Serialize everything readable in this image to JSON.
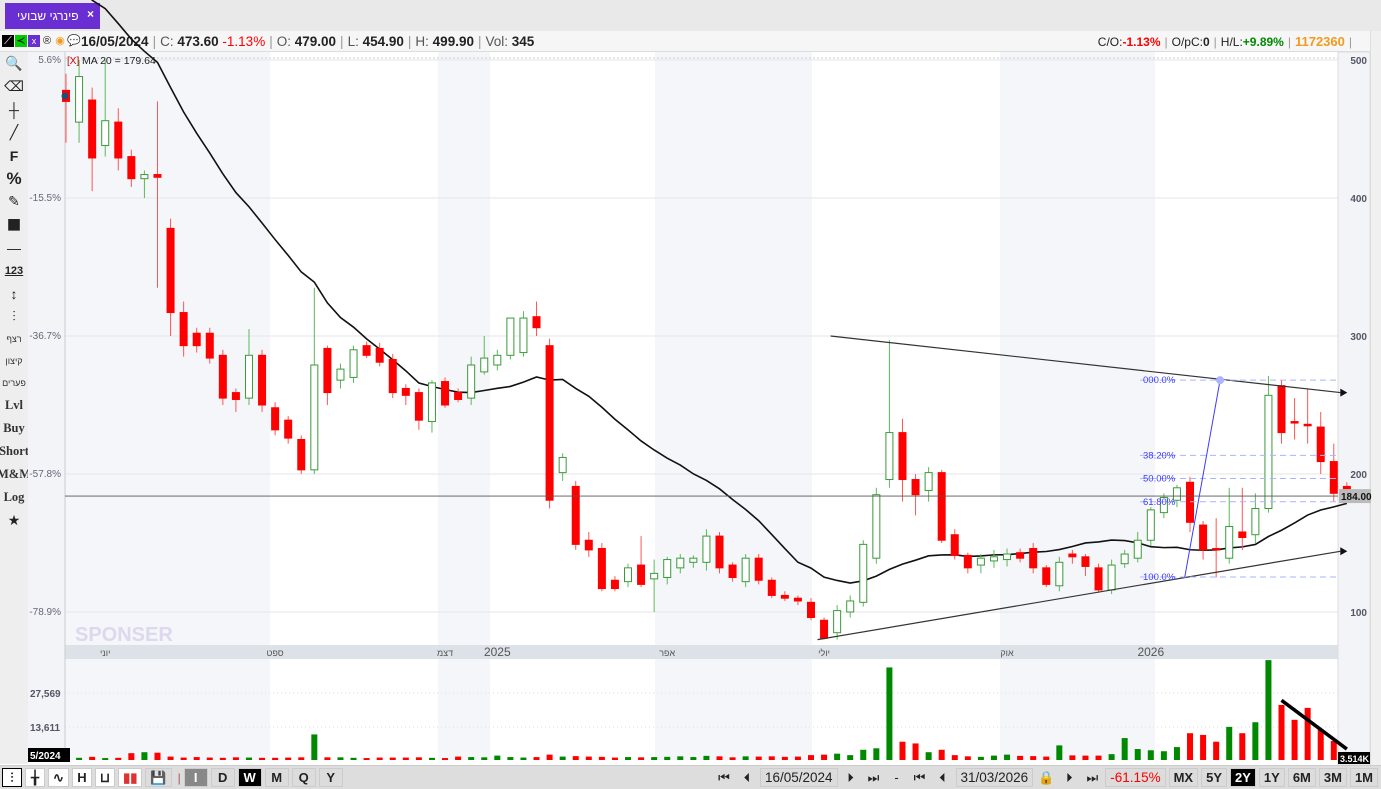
{
  "tab": {
    "title": "פינרגי שבועי",
    "close": "×"
  },
  "info": {
    "date": "16/05/2024",
    "c_label": "C:",
    "close": "473.60",
    "change": "-1.13%",
    "o_label": "O:",
    "open": "479.00",
    "l_label": "L:",
    "low": "454.90",
    "h_label": "H:",
    "high": "499.90",
    "vol_label": "Vol:",
    "vol": "345",
    "co_label": "C/O:",
    "co": "-1.13%",
    "opc_label": "O/pC:",
    "opc": "0",
    "hl_label": "H/L:",
    "hl": "+9.89%",
    "id": "1172360"
  },
  "left_tools": [
    {
      "name": "search-icon",
      "glyph": "🔍"
    },
    {
      "name": "eraser-icon",
      "glyph": "⌫"
    },
    {
      "name": "crosshair-icon",
      "glyph": "┼"
    },
    {
      "name": "line-tool-icon",
      "glyph": "╱"
    },
    {
      "name": "fib-tool",
      "glyph": "F"
    },
    {
      "name": "percent-tool",
      "glyph": "%"
    },
    {
      "name": "edit-icon",
      "glyph": "✎"
    },
    {
      "name": "color-swatch",
      "glyph": "■"
    },
    {
      "name": "line-width-icon",
      "glyph": "—"
    },
    {
      "name": "measure-123-tool",
      "glyph": "123"
    },
    {
      "name": "vertical-measure-icon",
      "glyph": "↕"
    },
    {
      "name": "candles-icon",
      "glyph": "⫶"
    }
  ],
  "left_text_tools": [
    "רצף",
    "קיצון",
    "פערים",
    "Lvl",
    "Buy",
    "Short",
    "M&M",
    "Log"
  ],
  "indicator": {
    "remove": "[X]",
    "label": "MA 20 = 179.64"
  },
  "price_line_label": "184.00",
  "volume_last_label": "3.514K",
  "watermark": "SPONSER",
  "bottom": {
    "chart_types": [
      "chart-candles",
      "chart-bars",
      "chart-line",
      "H",
      "chart-hollow",
      "chart-color"
    ],
    "periods": [
      "I",
      "D",
      "W",
      "M",
      "Q",
      "Y"
    ],
    "active_period": "W",
    "start_date": "16/05/2024",
    "end_date": "31/03/2026",
    "range_change": "-61.15%",
    "ranges": [
      "MX",
      "5Y",
      "2Y",
      "1Y",
      "6M",
      "3M",
      "1M"
    ],
    "active_range": "2Y",
    "first_nav": "⏮",
    "prev": "⏴",
    "next": "⏵",
    "last_nav": "⏭",
    "dash": "-"
  },
  "chart_data": {
    "type": "candlestick",
    "price_axis": {
      "ticks": [
        500,
        400,
        300,
        200,
        100
      ],
      "range": [
        70,
        500
      ]
    },
    "pct_axis": {
      "ticks": [
        "5.6%",
        "-15.5%",
        "-36.7%",
        "-57.8%",
        "-78.9%"
      ]
    },
    "volume_axis": {
      "ticks": [
        "27,569",
        "13,611"
      ]
    },
    "time_labels": [
      {
        "i": 3,
        "label": "יוני"
      },
      {
        "i": 16,
        "label": "ספט"
      },
      {
        "i": 29,
        "label": "דצמ"
      },
      {
        "i": 33,
        "label": "2025",
        "bold": true
      },
      {
        "i": 46,
        "label": "אפר"
      },
      {
        "i": 58,
        "label": "יולי"
      },
      {
        "i": 72,
        "label": "אוק"
      },
      {
        "i": 83,
        "label": "2026",
        "bold": true
      }
    ],
    "ma_period": 20,
    "last_price": 184.0,
    "candles": [
      [
        478,
        490,
        440,
        470
      ],
      [
        455,
        500,
        440,
        488
      ],
      [
        471,
        480,
        405,
        429
      ],
      [
        438,
        500,
        430,
        456
      ],
      [
        455,
        465,
        420,
        429
      ],
      [
        430,
        435,
        408,
        414
      ],
      [
        414,
        420,
        400,
        417
      ],
      [
        417,
        470,
        335,
        415
      ],
      [
        378,
        385,
        300,
        317
      ],
      [
        317,
        325,
        285,
        293
      ],
      [
        302,
        306,
        288,
        293
      ],
      [
        302,
        306,
        280,
        284
      ],
      [
        286,
        290,
        250,
        255
      ],
      [
        259,
        262,
        245,
        254
      ],
      [
        255,
        305,
        250,
        286
      ],
      [
        286,
        290,
        245,
        250
      ],
      [
        248,
        252,
        228,
        232
      ],
      [
        239,
        242,
        222,
        226
      ],
      [
        225,
        228,
        200,
        203
      ],
      [
        203,
        335,
        200,
        279
      ],
      [
        291,
        293,
        250,
        259
      ],
      [
        268,
        280,
        262,
        276
      ],
      [
        270,
        293,
        266,
        290
      ],
      [
        293,
        296,
        284,
        286
      ],
      [
        291,
        295,
        278,
        281
      ],
      [
        283,
        287,
        255,
        259
      ],
      [
        262,
        265,
        250,
        257
      ],
      [
        259,
        262,
        232,
        239
      ],
      [
        238,
        268,
        230,
        266
      ],
      [
        267,
        270,
        248,
        250
      ],
      [
        259,
        262,
        252,
        254
      ],
      [
        255,
        285,
        250,
        279
      ],
      [
        274,
        300,
        272,
        284
      ],
      [
        279,
        290,
        275,
        286
      ],
      [
        286,
        312,
        283,
        313
      ],
      [
        288,
        318,
        285,
        313
      ],
      [
        314,
        325,
        300,
        306
      ],
      [
        293,
        298,
        175,
        181
      ],
      [
        201,
        215,
        195,
        212
      ],
      [
        191,
        195,
        145,
        149
      ],
      [
        152,
        158,
        140,
        145
      ],
      [
        146,
        150,
        115,
        117
      ],
      [
        123,
        126,
        115,
        117
      ],
      [
        122,
        135,
        118,
        132
      ],
      [
        134,
        155,
        118,
        120
      ],
      [
        124,
        138,
        100,
        128
      ],
      [
        125,
        140,
        120,
        138
      ],
      [
        132,
        142,
        128,
        139
      ],
      [
        136,
        141,
        132,
        139
      ],
      [
        136,
        160,
        130,
        155
      ],
      [
        155,
        158,
        128,
        132
      ],
      [
        134,
        136,
        122,
        125
      ],
      [
        122,
        142,
        118,
        139
      ],
      [
        139,
        142,
        120,
        123
      ],
      [
        123,
        125,
        110,
        112
      ],
      [
        112,
        115,
        108,
        110
      ],
      [
        110,
        112,
        105,
        108
      ],
      [
        107,
        110,
        94,
        96
      ],
      [
        94,
        96,
        80,
        81
      ],
      [
        85,
        105,
        80,
        101
      ],
      [
        100,
        112,
        96,
        108
      ],
      [
        107,
        152,
        104,
        149
      ],
      [
        139,
        190,
        135,
        185
      ],
      [
        196,
        297,
        190,
        230
      ],
      [
        230,
        240,
        180,
        196
      ],
      [
        196,
        200,
        170,
        185
      ],
      [
        188,
        205,
        180,
        201
      ],
      [
        201,
        203,
        150,
        152
      ],
      [
        156,
        160,
        138,
        141
      ],
      [
        141,
        143,
        128,
        132
      ],
      [
        134,
        142,
        128,
        139
      ],
      [
        137,
        145,
        132,
        140
      ],
      [
        138,
        146,
        133,
        142
      ],
      [
        143,
        146,
        136,
        139
      ],
      [
        146,
        150,
        128,
        132
      ],
      [
        132,
        134,
        118,
        120
      ],
      [
        119,
        140,
        115,
        136
      ],
      [
        142,
        145,
        135,
        140
      ],
      [
        140,
        142,
        126,
        133
      ],
      [
        132,
        135,
        114,
        116
      ],
      [
        116,
        138,
        113,
        134
      ],
      [
        135,
        145,
        132,
        142
      ],
      [
        139,
        158,
        136,
        152
      ],
      [
        152,
        176,
        148,
        174
      ],
      [
        172,
        186,
        168,
        183
      ],
      [
        181,
        192,
        176,
        190
      ],
      [
        194,
        198,
        158,
        165
      ],
      [
        163,
        166,
        138,
        145
      ],
      [
        146,
        168,
        125,
        145
      ],
      [
        139,
        190,
        135,
        162
      ],
      [
        158,
        190,
        145,
        154
      ],
      [
        156,
        186,
        150,
        175
      ],
      [
        175,
        271,
        172,
        257
      ],
      [
        264,
        268,
        222,
        230
      ],
      [
        238,
        255,
        225,
        237
      ],
      [
        236,
        262,
        222,
        235
      ],
      [
        234,
        245,
        200,
        209
      ],
      [
        209,
        222,
        180,
        186
      ],
      [
        191,
        194,
        181,
        183
      ]
    ],
    "volumes": [
      1200,
      900,
      1300,
      800,
      900,
      2800,
      3200,
      3000,
      1400,
      1000,
      1200,
      1000,
      900,
      1100,
      1000,
      900,
      900,
      1000,
      1100,
      10500,
      1100,
      1100,
      900,
      800,
      1000,
      1000,
      1000,
      1100,
      900,
      800,
      1400,
      1200,
      1100,
      1800,
      1200,
      1000,
      1200,
      2200,
      1400,
      1600,
      1400,
      1300,
      1000,
      1200,
      1100,
      1200,
      1300,
      1500,
      1200,
      1700,
      1500,
      1100,
      1500,
      1400,
      1500,
      1300,
      1400,
      2000,
      2200,
      2600,
      2000,
      4200,
      4800,
      38000,
      7500,
      6800,
      3200,
      4200,
      2000,
      1500,
      1300,
      1800,
      2200,
      1700,
      1600,
      1400,
      6000,
      1900,
      1800,
      1800,
      2400,
      9000,
      4500,
      4000,
      3600,
      5300,
      11000,
      10300,
      7500,
      13600,
      11000,
      15500,
      41000,
      22600,
      16500,
      21400,
      12400,
      7800,
      3300
    ],
    "drawings": {
      "upper_trendline": {
        "from": [
          58.5,
          300
        ],
        "to": [
          97.5,
          259
        ]
      },
      "lower_trendline": {
        "from": [
          57.5,
          80
        ],
        "to": [
          97.5,
          144
        ]
      },
      "fibonacci": {
        "from": [
          85.6,
          125.4
        ],
        "to": [
          88.3,
          268
        ],
        "levels": [
          {
            "pct": 0,
            "label": "000.0%"
          },
          {
            "pct": 0.382,
            "label": "38.20%"
          },
          {
            "pct": 0.5,
            "label": "50.00%"
          },
          {
            "pct": 0.618,
            "label": "61.80%"
          },
          {
            "pct": 1,
            "label": "100.0%"
          }
        ]
      },
      "volume_trendline": {
        "from": [
          93,
          24500
        ],
        "to": [
          98,
          4500
        ]
      }
    }
  }
}
